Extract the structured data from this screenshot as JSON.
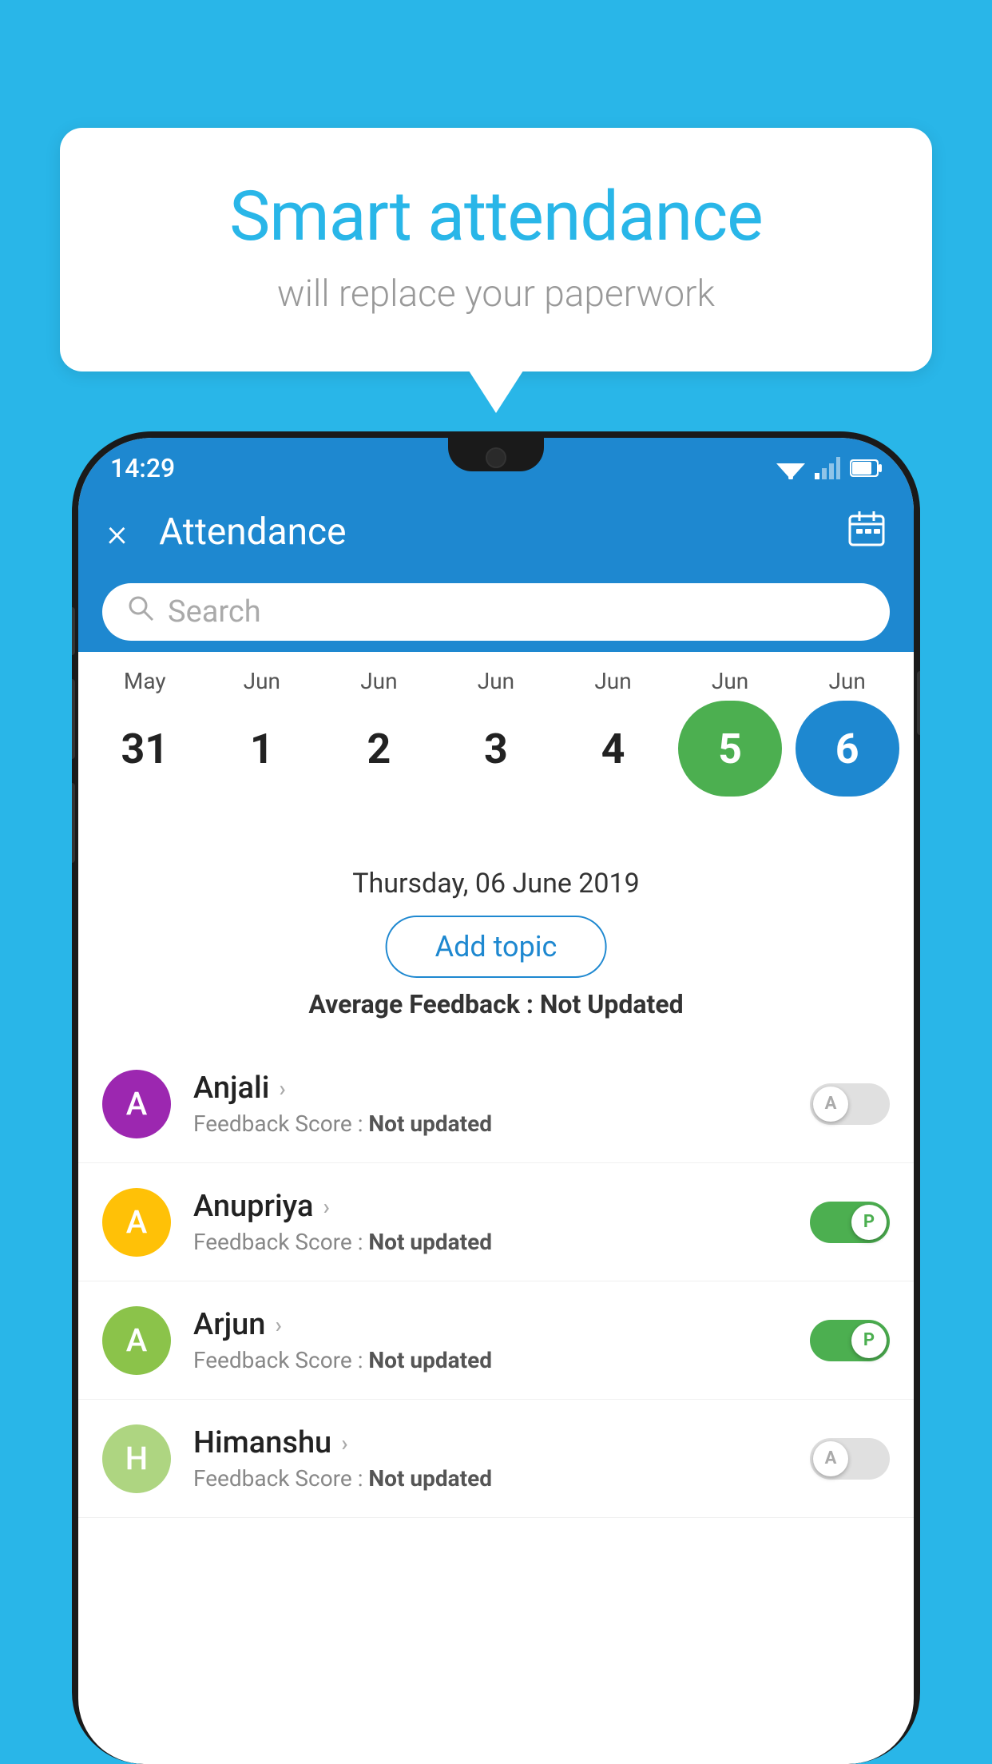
{
  "background_color": "#29b6e8",
  "speech_bubble": {
    "title": "Smart attendance",
    "subtitle": "will replace your paperwork"
  },
  "status_bar": {
    "time": "14:29"
  },
  "app_header": {
    "title": "Attendance",
    "close_label": "×",
    "calendar_icon": "📅"
  },
  "search": {
    "placeholder": "Search"
  },
  "dates": [
    {
      "month": "May",
      "day": "31",
      "state": "normal"
    },
    {
      "month": "Jun",
      "day": "1",
      "state": "normal"
    },
    {
      "month": "Jun",
      "day": "2",
      "state": "normal"
    },
    {
      "month": "Jun",
      "day": "3",
      "state": "normal"
    },
    {
      "month": "Jun",
      "day": "4",
      "state": "normal"
    },
    {
      "month": "Jun",
      "day": "5",
      "state": "today"
    },
    {
      "month": "Jun",
      "day": "6",
      "state": "selected"
    }
  ],
  "selected_date": "Thursday, 06 June 2019",
  "add_topic_label": "Add topic",
  "average_feedback": {
    "label": "Average Feedback : ",
    "value": "Not Updated"
  },
  "students": [
    {
      "name": "Anjali",
      "avatar_letter": "A",
      "avatar_color": "#9c27b0",
      "feedback_label": "Feedback Score : ",
      "feedback_value": "Not updated",
      "toggle_state": "off",
      "toggle_letter": "A"
    },
    {
      "name": "Anupriya",
      "avatar_letter": "A",
      "avatar_color": "#ffc107",
      "feedback_label": "Feedback Score : ",
      "feedback_value": "Not updated",
      "toggle_state": "on",
      "toggle_letter": "P"
    },
    {
      "name": "Arjun",
      "avatar_letter": "A",
      "avatar_color": "#8bc34a",
      "feedback_label": "Feedback Score : ",
      "feedback_value": "Not updated",
      "toggle_state": "on",
      "toggle_letter": "P"
    },
    {
      "name": "Himanshu",
      "avatar_letter": "H",
      "avatar_color": "#aed581",
      "feedback_label": "Feedback Score : ",
      "feedback_value": "Not updated",
      "toggle_state": "off",
      "toggle_letter": "A"
    }
  ]
}
